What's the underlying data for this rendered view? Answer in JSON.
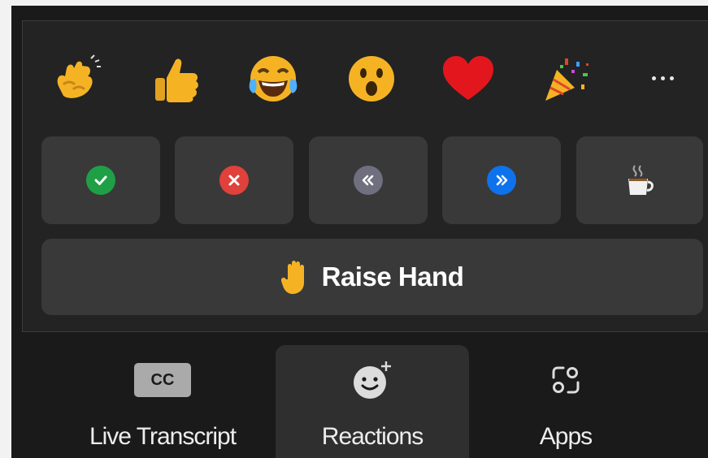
{
  "reactions": {
    "emojis": [
      {
        "name": "clapping-hands",
        "glyph": "👏"
      },
      {
        "name": "thumbs-up",
        "glyph": "👍"
      },
      {
        "name": "tears-of-joy",
        "glyph": "😂"
      },
      {
        "name": "open-mouth",
        "glyph": "😮"
      },
      {
        "name": "red-heart",
        "glyph": "❤️"
      },
      {
        "name": "party-popper",
        "glyph": "🎉"
      }
    ],
    "more_icon": "more-horizontal-icon",
    "feedback": [
      {
        "name": "yes",
        "icon": "check-icon",
        "color": "#1fa046"
      },
      {
        "name": "no",
        "icon": "x-icon",
        "color": "#e0413a"
      },
      {
        "name": "slow-down",
        "icon": "rewind-icon",
        "color": "#6f6f80"
      },
      {
        "name": "speed-up",
        "icon": "fast-forward-icon",
        "color": "#0e72ed"
      },
      {
        "name": "coffee",
        "icon": "coffee-icon",
        "color": "#f0f0f0"
      }
    ],
    "raise_hand": {
      "label": "Raise Hand",
      "icon": "raised-hand-icon"
    }
  },
  "toolbar": {
    "items": [
      {
        "label": "Live Transcript",
        "icon": "cc-icon",
        "icon_text": "CC",
        "active": false
      },
      {
        "label": "Reactions",
        "icon": "add-reaction-icon",
        "active": true
      },
      {
        "label": "Apps",
        "icon": "apps-icon",
        "active": false
      }
    ]
  },
  "colors": {
    "panel": "#232323",
    "tile": "#393939",
    "toolbar": "#1a1a1a",
    "text": "#ededed"
  }
}
